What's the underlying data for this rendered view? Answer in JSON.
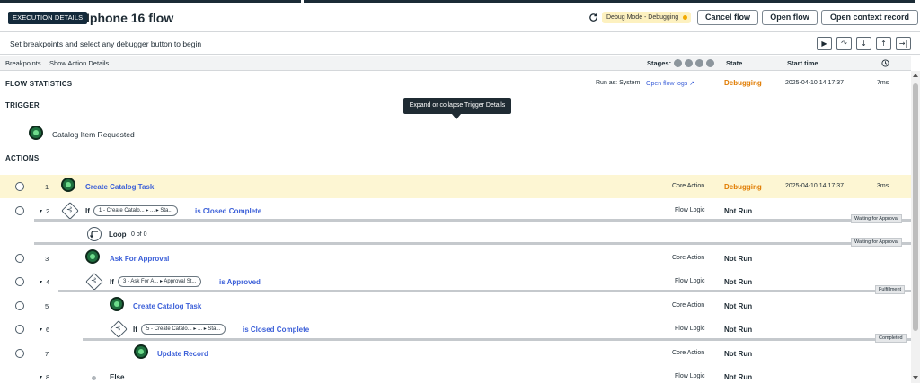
{
  "header": {
    "badge": "EXECUTION DETAILS",
    "title": "Iphone 16 flow",
    "debug_mode": "Debug Mode - Debugging",
    "cancel_label": "Cancel flow",
    "open_label": "Open flow",
    "context_label": "Open context record"
  },
  "subbar": {
    "text": "Set breakpoints and select any debugger button to begin",
    "buttons": [
      "▶",
      "↷",
      "↓",
      "↑",
      "→|"
    ]
  },
  "columns": {
    "breakpoints": "Breakpoints",
    "show_action_details": "Show Action Details",
    "stages": "Stages:",
    "state": "State",
    "start_time": "Start time"
  },
  "stats": {
    "label": "FLOW STATISTICS",
    "run_as": "Run as: System",
    "logs_link": "Open flow logs",
    "state": "Debugging",
    "start_time": "2025-04-10 14:17:37",
    "duration": "7ms"
  },
  "trigger": {
    "label": "TRIGGER",
    "name": "Catalog Item Requested"
  },
  "tooltip": "Expand or collapse Trigger Details",
  "actions_label": "ACTIONS",
  "rows": [
    {
      "num": "1",
      "name": "Create Catalog Task",
      "type": "Core Action",
      "state": "Debugging",
      "time": "2025-04-10 14:17:37",
      "dur": "3ms"
    },
    {
      "num": "2",
      "if": "If",
      "pill": "1 - Create Catalo... ▸ ... ▸ Sta...",
      "cond": "is Closed Complete",
      "type": "Flow Logic",
      "state": "Not Run",
      "stage": "Waiting for Approval"
    },
    {
      "loop": "Loop",
      "count": "0 of 0",
      "stage": "Waiting for Approval"
    },
    {
      "num": "3",
      "name": "Ask For Approval",
      "type": "Core Action",
      "state": "Not Run"
    },
    {
      "num": "4",
      "if": "If",
      "pill": "3 - Ask For A... ▸ Approval St...",
      "cond": "is Approved",
      "type": "Flow Logic",
      "state": "Not Run",
      "stage": "Fulfillment"
    },
    {
      "num": "5",
      "name": "Create Catalog Task",
      "type": "Core Action",
      "state": "Not Run"
    },
    {
      "num": "6",
      "if": "If",
      "pill": "5 - Create Catalo... ▸ ... ▸ Sta...",
      "cond": "is Closed Complete",
      "type": "Flow Logic",
      "state": "Not Run",
      "stage": "Completed"
    },
    {
      "num": "7",
      "name": "Update Record",
      "type": "Core Action",
      "state": "Not Run"
    },
    {
      "num": "8",
      "else": "Else",
      "type": "Flow Logic",
      "state": "Not Run"
    }
  ],
  "colors": {
    "accent": "#3b5fd8",
    "debugging": "#e07b00",
    "highlight": "#fdf6d3",
    "badge": "#142a3b"
  }
}
